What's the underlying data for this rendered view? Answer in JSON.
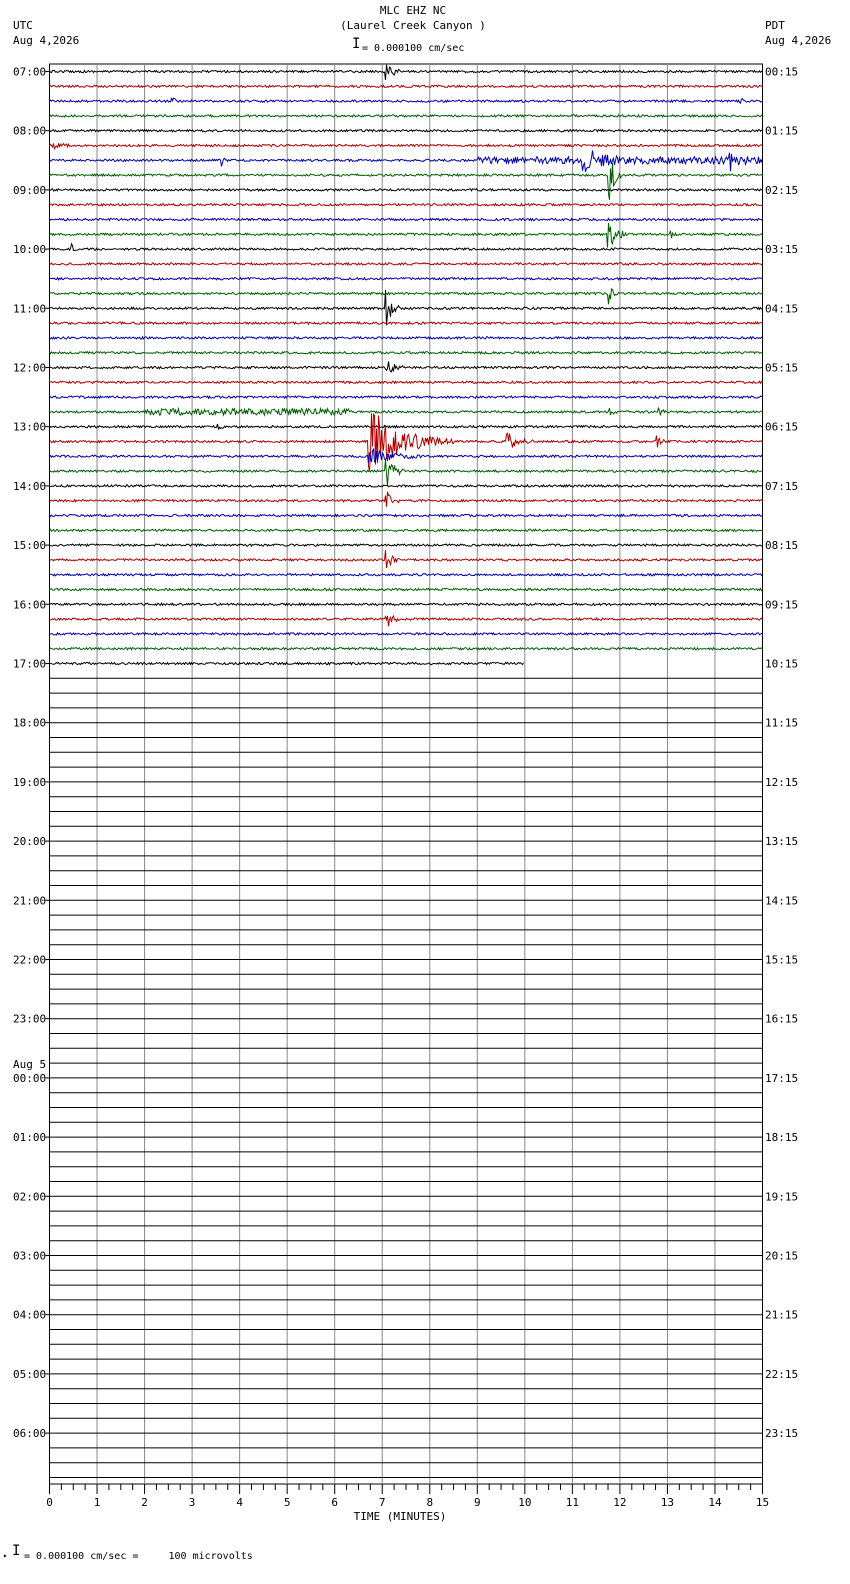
{
  "header": {
    "station": "MLC EHZ NC",
    "location": "(Laurel Creek Canyon )",
    "scale": "= 0.000100 cm/sec",
    "left_tz": "UTC",
    "left_date": "Aug 4,2026",
    "right_tz": "PDT",
    "right_date": "Aug 4,2026"
  },
  "footer": {
    "scale_note": "= 0.000100 cm/sec =     100 microvolts"
  },
  "chart_data": {
    "type": "line",
    "title": "MLC EHZ NC (Laurel Creek Canyon )",
    "xlabel": "TIME (MINUTES)",
    "xlim": [
      0,
      15
    ],
    "x_ticks": [
      "0",
      "1",
      "2",
      "3",
      "4",
      "5",
      "6",
      "7",
      "8",
      "9",
      "10",
      "11",
      "12",
      "13",
      "14",
      "15"
    ],
    "rows_total": 96,
    "rows_recorded": 41,
    "last_row_fraction": 0.665,
    "trace_colors": [
      "#000000",
      "#b00000",
      "#0000b0",
      "#006000"
    ],
    "left_labels": [
      {
        "row": 0,
        "text": "07:00"
      },
      {
        "row": 4,
        "text": "08:00"
      },
      {
        "row": 8,
        "text": "09:00"
      },
      {
        "row": 12,
        "text": "10:00"
      },
      {
        "row": 16,
        "text": "11:00"
      },
      {
        "row": 20,
        "text": "12:00"
      },
      {
        "row": 24,
        "text": "13:00"
      },
      {
        "row": 28,
        "text": "14:00"
      },
      {
        "row": 32,
        "text": "15:00"
      },
      {
        "row": 36,
        "text": "16:00"
      },
      {
        "row": 40,
        "text": "17:00"
      },
      {
        "row": 44,
        "text": "18:00"
      },
      {
        "row": 48,
        "text": "19:00"
      },
      {
        "row": 52,
        "text": "20:00"
      },
      {
        "row": 56,
        "text": "21:00"
      },
      {
        "row": 60,
        "text": "22:00"
      },
      {
        "row": 64,
        "text": "23:00"
      },
      {
        "row": 68,
        "text": "00:00",
        "date": "Aug 5"
      },
      {
        "row": 72,
        "text": "01:00"
      },
      {
        "row": 76,
        "text": "02:00"
      },
      {
        "row": 80,
        "text": "03:00"
      },
      {
        "row": 84,
        "text": "04:00"
      },
      {
        "row": 88,
        "text": "05:00"
      },
      {
        "row": 92,
        "text": "06:00"
      }
    ],
    "right_labels": [
      {
        "row": 0,
        "text": "00:15"
      },
      {
        "row": 4,
        "text": "01:15"
      },
      {
        "row": 8,
        "text": "02:15"
      },
      {
        "row": 12,
        "text": "03:15"
      },
      {
        "row": 16,
        "text": "04:15"
      },
      {
        "row": 20,
        "text": "05:15"
      },
      {
        "row": 24,
        "text": "06:15"
      },
      {
        "row": 28,
        "text": "07:15"
      },
      {
        "row": 32,
        "text": "08:15"
      },
      {
        "row": 36,
        "text": "09:15"
      },
      {
        "row": 40,
        "text": "10:15"
      },
      {
        "row": 44,
        "text": "11:15"
      },
      {
        "row": 48,
        "text": "12:15"
      },
      {
        "row": 52,
        "text": "13:15"
      },
      {
        "row": 56,
        "text": "14:15"
      },
      {
        "row": 60,
        "text": "15:15"
      },
      {
        "row": 64,
        "text": "16:15"
      },
      {
        "row": 68,
        "text": "17:15"
      },
      {
        "row": 72,
        "text": "18:15"
      },
      {
        "row": 76,
        "text": "19:15"
      },
      {
        "row": 80,
        "text": "20:15"
      },
      {
        "row": 84,
        "text": "21:15"
      },
      {
        "row": 88,
        "text": "22:15"
      },
      {
        "row": 92,
        "text": "23:15"
      }
    ],
    "noise_rows": [
      {
        "row": 6,
        "level": 2.5,
        "from": 9.0,
        "to": 15.0
      },
      {
        "row": 23,
        "level": 2.2,
        "from": 2.0,
        "to": 6.3
      }
    ],
    "events": [
      {
        "row": 0,
        "minute": 7.05,
        "amp": 1.6,
        "dur": 0.4
      },
      {
        "row": 2,
        "minute": 2.55,
        "amp": 1.6,
        "dur": 0.15
      },
      {
        "row": 2,
        "minute": 14.5,
        "amp": 1.2,
        "dur": 0.15
      },
      {
        "row": 5,
        "minute": 0.05,
        "amp": 0.7,
        "dur": 0.4
      },
      {
        "row": 6,
        "minute": 3.6,
        "amp": 1.2,
        "dur": 0.2
      },
      {
        "row": 6,
        "minute": 11.2,
        "amp": 2.0,
        "dur": 0.8
      },
      {
        "row": 6,
        "minute": 14.3,
        "amp": 1.4,
        "dur": 0.4
      },
      {
        "row": 7,
        "minute": 11.75,
        "amp": 4.5,
        "dur": 0.3
      },
      {
        "row": 11,
        "minute": 11.72,
        "amp": 3.2,
        "dur": 0.5
      },
      {
        "row": 11,
        "minute": 13.05,
        "amp": 0.8,
        "dur": 0.15
      },
      {
        "row": 12,
        "minute": 0.45,
        "amp": 0.8,
        "dur": 0.15
      },
      {
        "row": 15,
        "minute": 11.75,
        "amp": 2.0,
        "dur": 0.2
      },
      {
        "row": 16,
        "minute": 7.05,
        "amp": 4.0,
        "dur": 0.3
      },
      {
        "row": 20,
        "minute": 7.05,
        "amp": 2.0,
        "dur": 0.4
      },
      {
        "row": 23,
        "minute": 11.75,
        "amp": 0.9,
        "dur": 0.2
      },
      {
        "row": 23,
        "minute": 12.8,
        "amp": 0.8,
        "dur": 0.2
      },
      {
        "row": 24,
        "minute": 3.5,
        "amp": 0.6,
        "dur": 0.2
      },
      {
        "row": 25,
        "minute": 6.7,
        "amp": 5.0,
        "dur": 1.8
      },
      {
        "row": 25,
        "minute": 9.6,
        "amp": 1.4,
        "dur": 0.6
      },
      {
        "row": 25,
        "minute": 12.75,
        "amp": 1.3,
        "dur": 0.2
      },
      {
        "row": 26,
        "minute": 6.7,
        "amp": 1.2,
        "dur": 1.2
      },
      {
        "row": 27,
        "minute": 7.05,
        "amp": 3.0,
        "dur": 0.4
      },
      {
        "row": 29,
        "minute": 7.05,
        "amp": 2.0,
        "dur": 0.3
      },
      {
        "row": 33,
        "minute": 7.05,
        "amp": 2.0,
        "dur": 0.3
      },
      {
        "row": 37,
        "minute": 7.05,
        "amp": 2.0,
        "dur": 0.3
      }
    ]
  }
}
